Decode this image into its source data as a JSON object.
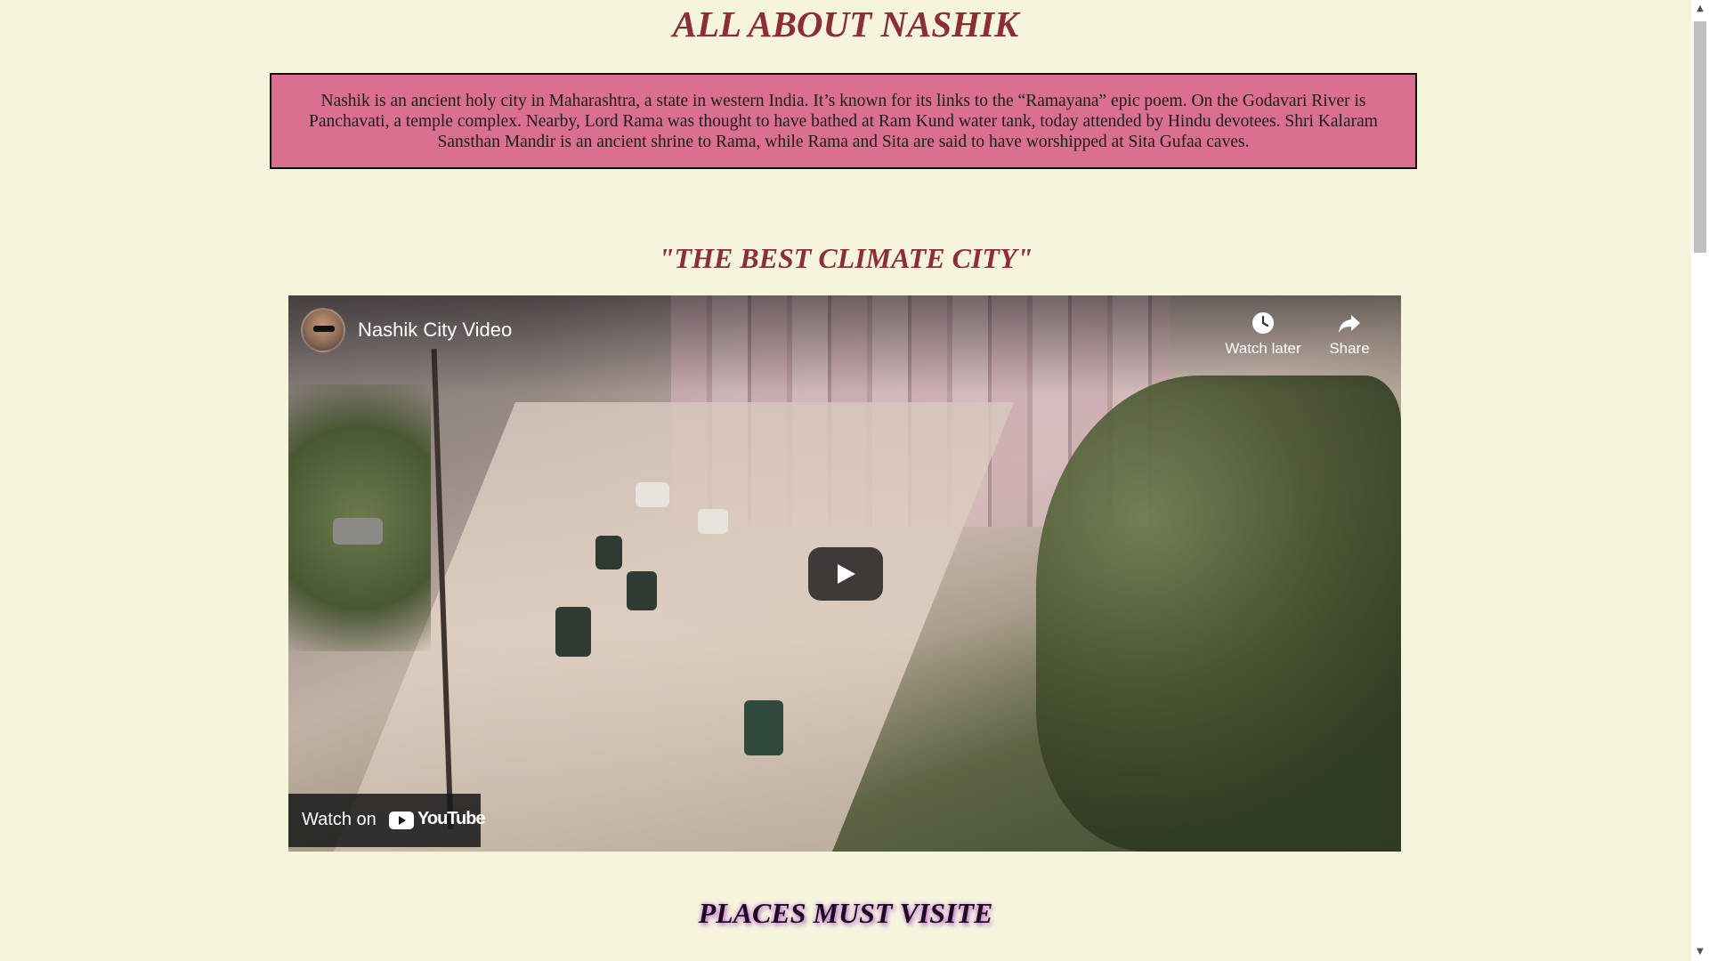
{
  "page": {
    "title": "ALL ABOUT NASHIK",
    "intro": "Nashik is an ancient holy city in Maharashtra, a state in western India. It’s known for its links to the “Ramayana” epic poem. On the Godavari River is Panchavati, a temple complex. Nearby, Lord Rama was thought to have bathed at Ram Kund water tank, today attended by Hindu devotees. Shri Kalaram Sansthan Mandir is an ancient shrine to Rama, while Rama and Sita are said to have worshipped at Sita Gufaa caves.",
    "subtitle": "\"THE BEST CLIMATE CITY\"",
    "section_heading": "PLACES MUST VISITE"
  },
  "video": {
    "title": "Nashik City Video",
    "watch_later_label": "Watch later",
    "share_label": "Share",
    "watch_on_label": "Watch on",
    "youtube_label": "YouTube",
    "icons": [
      "clock-icon",
      "share-arrow-icon",
      "play-icon",
      "youtube-logo-icon"
    ]
  },
  "colors": {
    "background": "#f5f5dc",
    "heading": "#8b2e35",
    "intro_box": "#db6f8f",
    "section_heading_glow": "#c07ad0"
  },
  "scrollbar": {
    "up_arrow": "▲",
    "down_arrow": "▼"
  }
}
